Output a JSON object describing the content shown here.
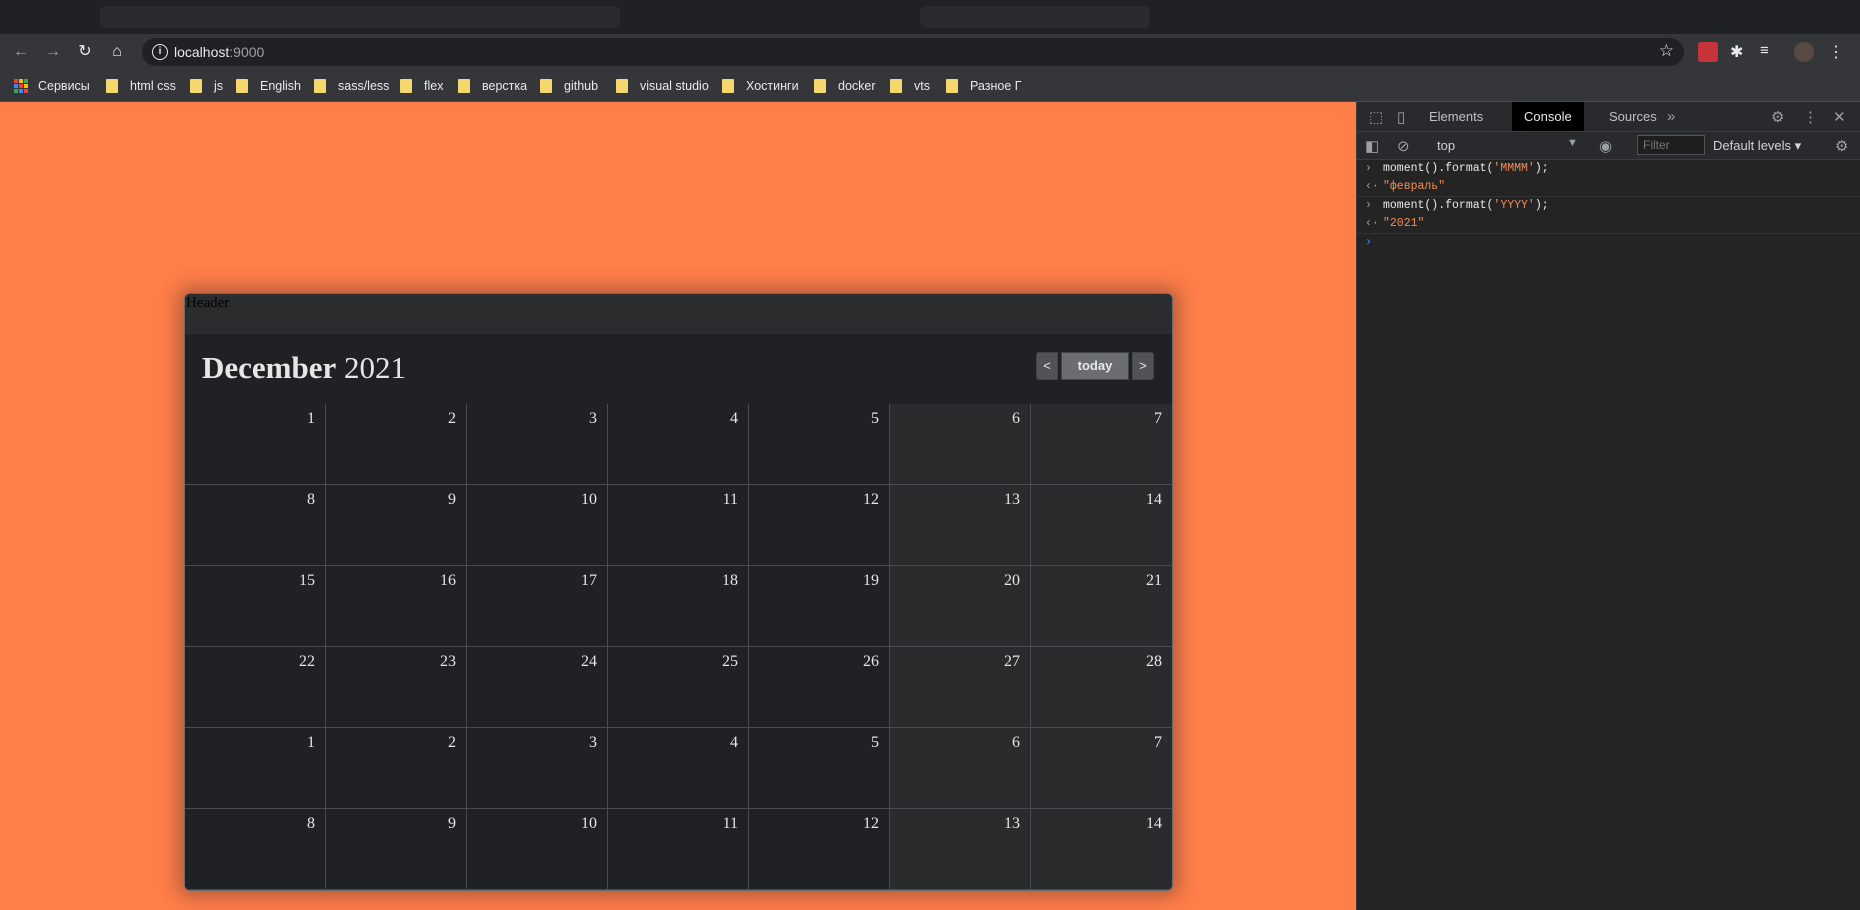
{
  "browser": {
    "url_host": "localhost",
    "url_port": ":9000",
    "bookmarks": [
      {
        "label": "Сервисы"
      },
      {
        "label": "html css"
      },
      {
        "label": "js"
      },
      {
        "label": "English"
      },
      {
        "label": "sass/less"
      },
      {
        "label": "flex"
      },
      {
        "label": "верстка"
      },
      {
        "label": "github"
      },
      {
        "label": "visual studio"
      },
      {
        "label": "Хостинги"
      },
      {
        "label": "docker"
      },
      {
        "label": "vts"
      },
      {
        "label": "Разное Г"
      }
    ]
  },
  "calendar": {
    "header_label": "Header",
    "month": "December",
    "year": "2021",
    "prev_label": "<",
    "today_label": "today",
    "next_label": ">",
    "weeks": [
      [
        "1",
        "2",
        "3",
        "4",
        "5",
        "6",
        "7"
      ],
      [
        "8",
        "9",
        "10",
        "11",
        "12",
        "13",
        "14"
      ],
      [
        "15",
        "16",
        "17",
        "18",
        "19",
        "20",
        "21"
      ],
      [
        "22",
        "23",
        "24",
        "25",
        "26",
        "27",
        "28"
      ],
      [
        "1",
        "2",
        "3",
        "4",
        "5",
        "6",
        "7"
      ],
      [
        "8",
        "9",
        "10",
        "11",
        "12",
        "13",
        "14"
      ]
    ]
  },
  "devtools": {
    "tabs": [
      "Elements",
      "Console",
      "Sources"
    ],
    "active_tab": "Console",
    "context": "top",
    "filter_placeholder": "Filter",
    "levels": "Default levels",
    "console": [
      {
        "type": "input",
        "text_pre": "moment().format(",
        "text_str": "'MMMM'",
        "text_post": ");"
      },
      {
        "type": "result",
        "text_str": "\"февраль\""
      },
      {
        "type": "input",
        "text_pre": "moment().format(",
        "text_str": "'YYYY'",
        "text_post": ");"
      },
      {
        "type": "result",
        "text_str": "\"2021\""
      }
    ]
  },
  "colors": {
    "page_bg": "#ff7e4a",
    "calendar_bg": "#202124",
    "devtools_bg": "#242424",
    "string": "#f28b54"
  }
}
